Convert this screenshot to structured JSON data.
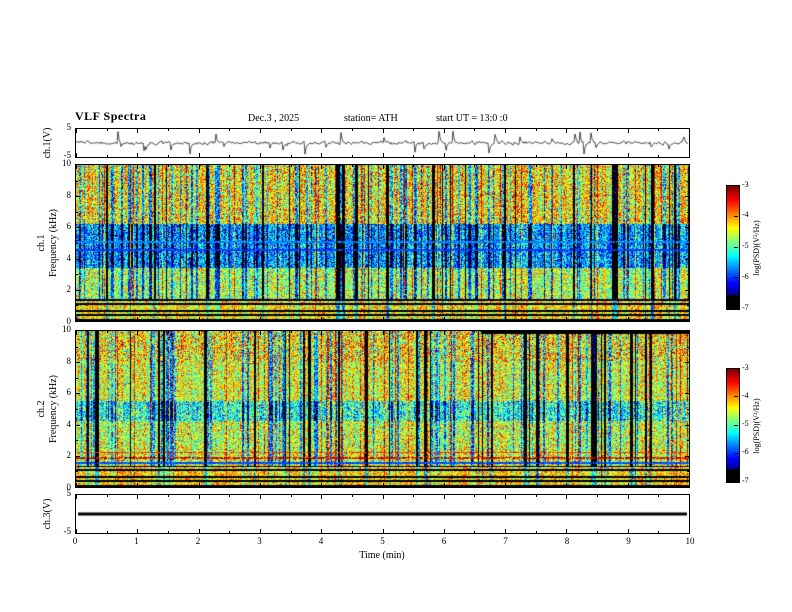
{
  "title": "VLF  Spectra",
  "header": {
    "date": "Dec.3  , 2025",
    "station": "station= ATH",
    "start_ut": "start UT =  13:0 :0"
  },
  "xaxis": {
    "label": "Time (min)",
    "range": [
      0,
      10
    ],
    "major_ticks": [
      0,
      1,
      2,
      3,
      4,
      5,
      6,
      7,
      8,
      9,
      10
    ],
    "minor_step": 0.5
  },
  "chart_data": [
    {
      "type": "line",
      "name": "ch1-waveform",
      "ylabel": "ch.1(V)",
      "ylim": [
        -5,
        5
      ],
      "yticks": [
        5,
        -5
      ],
      "xlim": [
        0,
        10
      ],
      "description": "Noisy broadband waveform centred near 0 V with frequent impulsive sferic spikes reaching about ±4 V",
      "render": {
        "seed": 20251203,
        "noise_amp": 0.55,
        "spike_prob": 0.05,
        "spike_amp": 3.2
      }
    },
    {
      "type": "heatmap",
      "name": "ch1-spectrogram",
      "ylabel_lines": [
        "ch.1",
        "Frequency (kHz)"
      ],
      "ylim": [
        0,
        10
      ],
      "xlim": [
        0,
        10
      ],
      "yticks": [
        0,
        2,
        4,
        6,
        8,
        10
      ],
      "colorbar": {
        "label": "log(PSD)(V²/Hz)",
        "ticks": [
          -3,
          -4,
          -5,
          -6,
          -7
        ],
        "range": [
          -7,
          -3
        ]
      },
      "description": "VLF spectrogram: green/yellow background, dense dark-blue and black vertical sferic streaks, suppressed blue band around 3.5-6 kHz, black/green horizontal stripes below about 1.3 kHz",
      "render": {
        "seed": 11,
        "base": -4.65,
        "noise": 0.8,
        "speck_prob": 0.012,
        "stripe_top": 1.3,
        "stripe_pattern": [
          1,
          0,
          1,
          0,
          1,
          0,
          0,
          1,
          0
        ],
        "bands": [
          {
            "f0": 3.4,
            "f1": 6.2,
            "delta": -1.25,
            "noise": 0.6
          },
          {
            "f0": 6.2,
            "f1": 10,
            "delta": 0.2,
            "noise": 1.1
          },
          {
            "f0": 1.3,
            "f1": 3.4,
            "delta": -0.15,
            "noise": 0.7
          }
        ],
        "hlines": [
          {
            "f": 4.55,
            "delta": -1.6,
            "wf": 0.07
          },
          {
            "f": 5.05,
            "delta": -1.3,
            "wf": 0.06
          },
          {
            "f": 1.33,
            "delta": -2.4,
            "wf": 0.05
          }
        ],
        "streaks": {
          "dark_prob": 0.055,
          "dark_delta": -2.7,
          "med_prob": 0.13,
          "med_delta": -1.1,
          "bright_prob": 0.05,
          "bright_delta": 0.9
        }
      }
    },
    {
      "type": "heatmap",
      "name": "ch2-spectrogram",
      "ylabel_lines": [
        "ch.2",
        "Frequency (kHz)"
      ],
      "ylim": [
        0,
        10
      ],
      "xlim": [
        0,
        10
      ],
      "yticks": [
        0,
        2,
        4,
        6,
        8,
        10
      ],
      "colorbar": {
        "label": "log(PSD)(V²/Hz)",
        "ticks": [
          -3,
          -4,
          -5,
          -6,
          -7
        ],
        "range": [
          -7,
          -3
        ]
      },
      "description": "VLF spectrogram: similar streaky structure, orange/red horizontal interference lines near 2 kHz, black bar along the top edge from about 6.6 to 10 min",
      "render": {
        "seed": 22,
        "base": -4.6,
        "noise": 0.85,
        "speck_prob": 0.014,
        "stripe_top": 1.3,
        "stripe_pattern": [
          1,
          0,
          1,
          0,
          1,
          0,
          0,
          1,
          0
        ],
        "bands": [
          {
            "f0": 8,
            "f1": 10,
            "delta": 0.15,
            "noise": 1.2
          },
          {
            "f0": 4.2,
            "f1": 5.5,
            "delta": -0.8,
            "noise": 0.5
          },
          {
            "f0": 2.6,
            "f1": 4.2,
            "delta": -0.1,
            "noise": 0.6
          }
        ],
        "hlines": [
          {
            "f": 1.85,
            "delta": 1.3,
            "wf": 0.07,
            "broken": true
          },
          {
            "f": 2.2,
            "delta": 1.0,
            "wf": 0.05,
            "broken": true
          },
          {
            "f": 1.55,
            "delta": -1.6,
            "wf": 0.05
          },
          {
            "f": 1.33,
            "delta": -2.4,
            "wf": 0.04
          }
        ],
        "top_bar": {
          "t0": 6.6,
          "t1": 10,
          "df": 0.18
        },
        "streaks": {
          "dark_prob": 0.07,
          "dark_delta": -2.8,
          "med_prob": 0.12,
          "med_delta": -1.0,
          "bright_prob": 0.05,
          "bright_delta": 0.9
        }
      }
    },
    {
      "type": "line",
      "name": "ch3-waveform",
      "ylabel": "ch.3(V)",
      "ylim": [
        -5,
        5
      ],
      "yticks": [
        5,
        -5
      ],
      "xlim": [
        0,
        10
      ],
      "description": "Flat constant line at about 0 V (channel inactive)",
      "render": {
        "value": 0,
        "line_width": 3
      }
    }
  ]
}
